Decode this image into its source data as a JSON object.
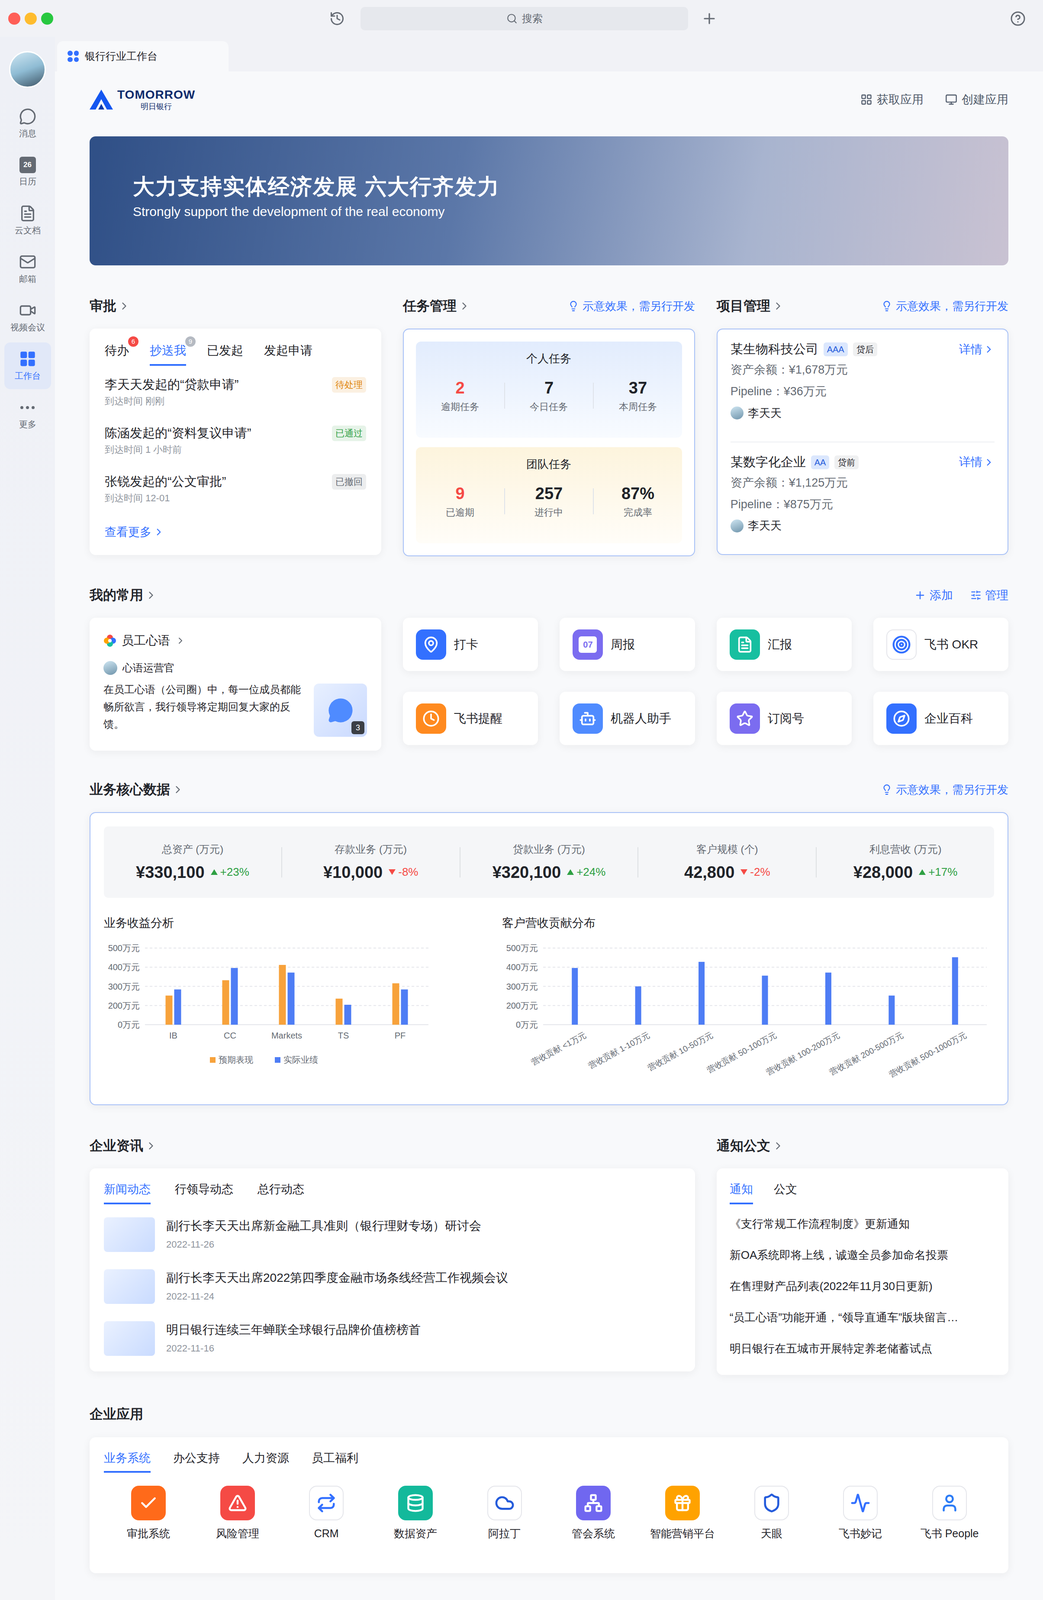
{
  "topbar": {
    "search_placeholder": "搜索"
  },
  "sidebar": {
    "items": [
      {
        "label": "消息",
        "icon_text": "",
        "selected": false
      },
      {
        "label": "日历",
        "icon_text": "26",
        "selected": false
      },
      {
        "label": "云文档",
        "icon_text": "",
        "selected": false
      },
      {
        "label": "邮箱",
        "icon_text": "",
        "selected": false
      },
      {
        "label": "视频会议",
        "icon_text": "",
        "selected": false
      },
      {
        "label": "工作台",
        "icon_text": "",
        "selected": true
      },
      {
        "label": "更多",
        "icon_text": "",
        "selected": false
      }
    ]
  },
  "tab": {
    "label": "银行行业工作台",
    "selected": true
  },
  "brand": {
    "name": "TOMORROW",
    "subname": "明日银行"
  },
  "header_actions": [
    "获取应用",
    "创建应用"
  ],
  "banner": {
    "title": "大力支持实体经济发展 六大行齐发力",
    "subtitle": "Strongly support the development of the real economy"
  },
  "approval": {
    "title": "审批",
    "tabs": [
      {
        "label": "待办",
        "badge": "6",
        "badge_color": "#f54a45",
        "selected": false
      },
      {
        "label": "抄送我",
        "badge": "9",
        "badge_color": "#b5bac2",
        "selected": true
      },
      {
        "label": "已发起",
        "badge": "",
        "badge_color": "",
        "selected": false
      },
      {
        "label": "发起申请",
        "badge": "",
        "badge_color": "",
        "selected": false
      }
    ],
    "items": [
      {
        "title": "李天天发起的“贷款申请”",
        "time": "到达时间 刚刚",
        "status": "待处理",
        "color": "#e0850a"
      },
      {
        "title": "陈涵发起的“资料复议申请”",
        "time": "到达时间 1 小时前",
        "status": "已通过",
        "color": "#2ea043"
      },
      {
        "title": "张锐发起的“公文审批”",
        "time": "到达时间 12-01",
        "status": "已撤回",
        "color": "#646a73"
      }
    ],
    "more": "查看更多"
  },
  "tasks": {
    "title": "任务管理",
    "hint": "示意效果，需另行开发",
    "groups": [
      {
        "title": "个人任务",
        "kind": "personal",
        "stats": [
          {
            "value": "2",
            "label": "逾期任务",
            "alert": true
          },
          {
            "value": "7",
            "label": "今日任务",
            "alert": false
          },
          {
            "value": "37",
            "label": "本周任务",
            "alert": false
          }
        ]
      },
      {
        "title": "团队任务",
        "kind": "team",
        "stats": [
          {
            "value": "9",
            "label": "已逾期",
            "alert": true
          },
          {
            "value": "257",
            "label": "进行中",
            "alert": false
          },
          {
            "value": "87%",
            "label": "完成率",
            "alert": false
          }
        ]
      }
    ]
  },
  "projects": {
    "title": "项目管理",
    "hint": "示意效果，需另行开发",
    "items": [
      {
        "name": "某生物科技公司",
        "rating": "AAA",
        "stage": "贷后",
        "detail": "详情",
        "balance": "资产余额：¥1,678万元",
        "pipeline": "Pipeline：¥36万元",
        "owner": "李天天"
      },
      {
        "name": "某数字化企业",
        "rating": "AA",
        "stage": "贷前",
        "detail": "详情",
        "balance": "资产余额：¥1,125万元",
        "pipeline": "Pipeline：¥875万元",
        "owner": "李天天"
      }
    ]
  },
  "favorites": {
    "title": "我的常用",
    "add": "添加",
    "manage": "管理",
    "feed": {
      "name": "员工心语",
      "author": "心语运营官",
      "text": "在员工心语（公司圈）中，每一位成员都能畅所欲言，我行领导将定期回复大家的反馈。",
      "count": "3"
    },
    "apps": [
      {
        "label": "打卡",
        "kind": "filled",
        "color": "#3370ff",
        "icon_text": ""
      },
      {
        "label": "周报",
        "kind": "filled",
        "color": "#7b6cf0",
        "icon_text": "07"
      },
      {
        "label": "汇报",
        "kind": "filled",
        "color": "#17bfa0",
        "icon_text": ""
      },
      {
        "label": "飞书 OKR",
        "kind": "plain",
        "color": "#3370ff",
        "icon_text": ""
      },
      {
        "label": "飞书提醒",
        "kind": "filled",
        "color": "#ff8a1f",
        "icon_text": ""
      },
      {
        "label": "机器人助手",
        "kind": "filled",
        "color": "#4f8bff",
        "icon_text": ""
      },
      {
        "label": "订阅号",
        "kind": "filled",
        "color": "#7b6cf0",
        "icon_text": ""
      },
      {
        "label": "企业百科",
        "kind": "filled",
        "color": "#3370ff",
        "icon_text": ""
      }
    ]
  },
  "core": {
    "title": "业务核心数据",
    "hint": "示意效果，需另行开发",
    "kpis": [
      {
        "label": "总资产 (万元)",
        "value": "¥330,100",
        "change": "+23%",
        "trend": "up"
      },
      {
        "label": "存款业务 (万元)",
        "value": "¥10,000",
        "change": "-8%",
        "trend": "down"
      },
      {
        "label": "贷款业务 (万元)",
        "value": "¥320,100",
        "change": "+24%",
        "trend": "up"
      },
      {
        "label": "客户规模 (个)",
        "value": "42,800",
        "change": "-2%",
        "trend": "down"
      },
      {
        "label": "利息营收 (万元)",
        "value": "¥28,000",
        "change": "+17%",
        "trend": "up"
      }
    ],
    "revenue_chart": {
      "title": "业务收益分析",
      "y_ticks": [
        "500万元",
        "400万元",
        "300万元",
        "200万元",
        "0万元"
      ],
      "categories": [
        "IB",
        "CC",
        "Markets",
        "TS",
        "PF"
      ],
      "series": [
        {
          "name": "预期表现",
          "color": "#f7a23b",
          "values": [
            190,
            290,
            390,
            170,
            270
          ]
        },
        {
          "name": "实际业绩",
          "color": "#4e7df5",
          "values": [
            230,
            370,
            340,
            130,
            230
          ]
        }
      ]
    },
    "contribution_chart": {
      "title": "客户营收贡献分布",
      "y_ticks": [
        "500万元",
        "400万元",
        "300万元",
        "200万元",
        "0万元"
      ],
      "categories": [
        "营收贡献 <1万元",
        "营收贡献 1-10万元",
        "营收贡献 10-50万元",
        "营收贡献 50-100万元",
        "营收贡献 100-200万元",
        "营收贡献 200-500万元",
        "营收贡献 500-1000万元"
      ],
      "values": [
        370,
        250,
        410,
        320,
        340,
        190,
        440
      ]
    }
  },
  "news": {
    "title": "企业资讯",
    "tabs": [
      {
        "label": "新闻动态",
        "selected": true
      },
      {
        "label": "行领导动态",
        "selected": false
      },
      {
        "label": "总行动态",
        "selected": false
      }
    ],
    "items": [
      {
        "title": "副行长李天天出席新金融工具准则（银行理财专场）研讨会",
        "date": "2022-11-26"
      },
      {
        "title": "副行长李天天出席2022第四季度金融市场条线经营工作视频会议",
        "date": "2022-11-24"
      },
      {
        "title": "明日银行连续三年蝉联全球银行品牌价值榜榜首",
        "date": "2022-11-16"
      }
    ]
  },
  "notices": {
    "title": "通知公文",
    "tabs": [
      {
        "label": "通知",
        "selected": true
      },
      {
        "label": "公文",
        "selected": false
      }
    ],
    "items": [
      "《支行常规工作流程制度》更新通知",
      "新OA系统即将上线，诚邀全员参加命名投票",
      "在售理财产品列表(2022年11月30日更新)",
      "“员工心语”功能开通，“领导直通车”版块留言…",
      "明日银行在五城市开展特定养老储蓄试点"
    ]
  },
  "enterprise_apps": {
    "title": "企业应用",
    "tabs": [
      {
        "label": "业务系统",
        "selected": true
      },
      {
        "label": "办公支持",
        "selected": false
      },
      {
        "label": "人力资源",
        "selected": false
      },
      {
        "label": "员工福利",
        "selected": false
      }
    ],
    "apps": [
      {
        "label": "审批系统",
        "kind": "filled",
        "color": "#ff6a1a"
      },
      {
        "label": "风险管理",
        "kind": "filled",
        "color": "#f54a45"
      },
      {
        "label": "CRM",
        "kind": "plain",
        "color": "#3370ff"
      },
      {
        "label": "数据资产",
        "kind": "filled",
        "color": "#13b99b"
      },
      {
        "label": "阿拉丁",
        "kind": "plain",
        "color": "#245bdb"
      },
      {
        "label": "管会系统",
        "kind": "filled",
        "color": "#7067f0"
      },
      {
        "label": "智能营销平台",
        "kind": "filled",
        "color": "#ffa200"
      },
      {
        "label": "天眼",
        "kind": "plain",
        "color": "#245bdb"
      },
      {
        "label": "飞书妙记",
        "kind": "plain",
        "color": "#3370ff"
      },
      {
        "label": "飞书 People",
        "kind": "plain",
        "color": "#2c7cf6"
      }
    ]
  }
}
